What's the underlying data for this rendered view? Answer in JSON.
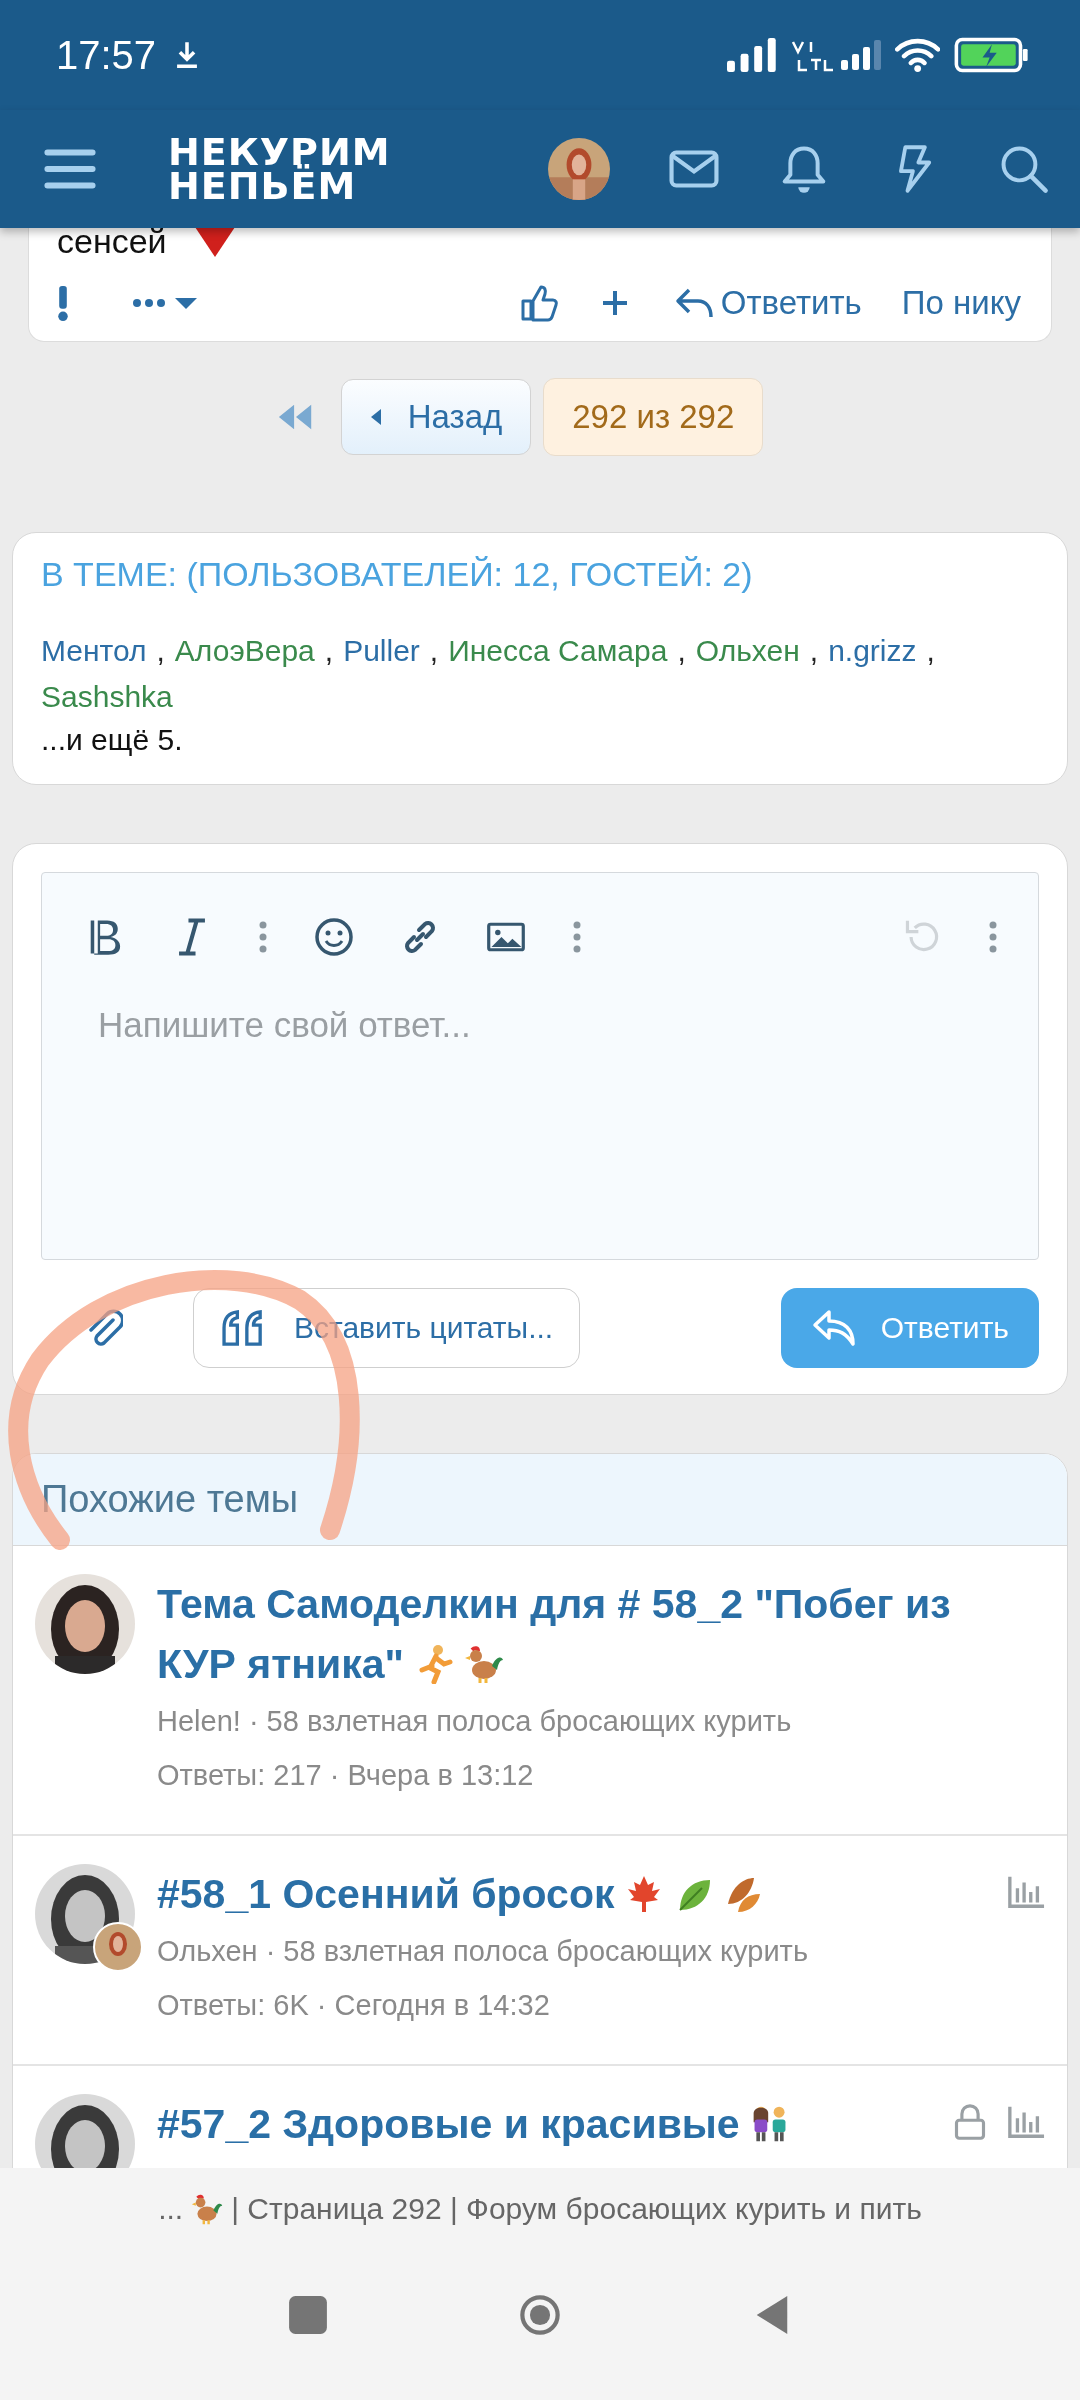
{
  "status_bar": {
    "time": "17:57"
  },
  "header": {
    "logo_lines": [
      "НЕКУРИМ",
      "НЕПЬЁМ"
    ]
  },
  "post": {
    "text": "сенсей",
    "reply": "Ответить",
    "by_nick": "По нику"
  },
  "pagination": {
    "back": "Назад",
    "current": "292 из 292"
  },
  "online": {
    "title": "В ТЕМЕ: (ПОЛЬЗОВАТЕЛЕЙ: 12, ГОСТЕЙ: 2)",
    "separator": ",",
    "users": [
      {
        "name": "Ментол",
        "color": "#2c6ea6"
      },
      {
        "name": "АлоэВера",
        "color": "#3a8a4c"
      },
      {
        "name": "Puller",
        "color": "#2c6ea6"
      },
      {
        "name": "Инесса Самара",
        "color": "#3a8a4c"
      },
      {
        "name": "Ольхен",
        "color": "#3a8a4c"
      },
      {
        "name": "n.grizz",
        "color": "#2c6ea6"
      },
      {
        "name": "Sashshka",
        "color": "#3a8a4c"
      }
    ],
    "more": "...и ещё 5."
  },
  "editor": {
    "placeholder": "Напишите свой ответ...",
    "insert_quotes": "Вставить цитаты...",
    "submit": "Ответить"
  },
  "similar": {
    "title": "Похожие темы",
    "threads": [
      {
        "title": "Тема Самоделкин для # 58_2 \"Побег из КУР ятника\"",
        "emojis": [
          {
            "kind": "runner"
          },
          {
            "kind": "rooster"
          }
        ],
        "meta": "Helen! · 58 взлетная полоса бросающих курить",
        "stats_line": "Ответы: 217 · Вчера в 13:12",
        "locked": false,
        "has_stats": false,
        "second_avatar": false
      },
      {
        "title": "#58_1 Осенний бросок",
        "emojis": [
          {
            "kind": "maple"
          },
          {
            "kind": "leaf"
          },
          {
            "kind": "leaves"
          }
        ],
        "meta": "Ольхен · 58 взлетная полоса бросающих курить",
        "stats_line": "Ответы: 6K · Сегодня в 14:32",
        "locked": false,
        "has_stats": true,
        "second_avatar": true
      },
      {
        "title": "#57_2 Здоровые и красивые",
        "emojis": [
          {
            "kind": "couple"
          }
        ],
        "locked": true,
        "has_stats": true,
        "second_avatar": false
      }
    ]
  },
  "browser_bar": {
    "prefix": "...",
    "title": "| Страница 292 | Форум бросающих курить и пить"
  }
}
